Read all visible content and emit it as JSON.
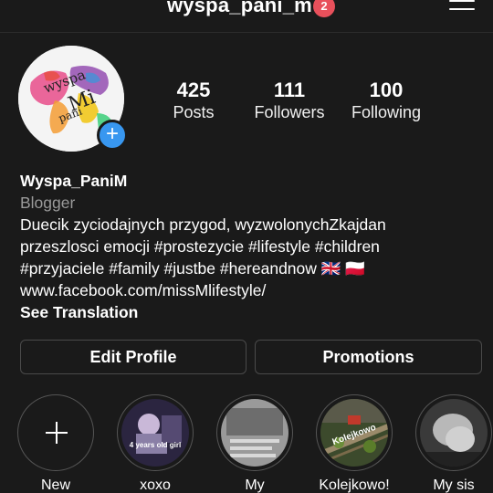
{
  "header": {
    "username": "wyspa_pani_m",
    "notification_count": "2",
    "menu_icon": "hamburger-menu-icon"
  },
  "profile": {
    "avatar_text": "wyspa pani M",
    "add_story_icon": "plus-icon",
    "stats": [
      {
        "value": "425",
        "label": "Posts"
      },
      {
        "value": "111",
        "label": "Followers"
      },
      {
        "value": "100",
        "label": "Following"
      }
    ]
  },
  "bio": {
    "name": "Wyspa_PaniM",
    "category": "Blogger",
    "line1": "Duecik zyciodajnych przygod, wyzwolonychZkajdan",
    "line2": "przeszlosci emocji #prostezycie #lifestyle #children",
    "line3": "#przyjaciele #family #justbe #hereandnow 🇬🇧 🇵🇱",
    "link": "www.facebook.com/missMlifestyle/",
    "see_translation": "See Translation"
  },
  "actions": {
    "edit_profile": "Edit Profile",
    "promotions": "Promotions"
  },
  "highlights": [
    {
      "label": "New",
      "icon": "plus-icon"
    },
    {
      "label": "xoxo",
      "overlay": "4 years old girl"
    },
    {
      "label": "My",
      "overlay": ""
    },
    {
      "label": "Kolejkowo!",
      "overlay": "Kolejkowo"
    },
    {
      "label": "My sis",
      "overlay": ""
    }
  ],
  "colors": {
    "background": "#1a1a1a",
    "accent_blue": "#3897f0",
    "badge_red": "#e8505b",
    "border": "#4a4a4a"
  }
}
